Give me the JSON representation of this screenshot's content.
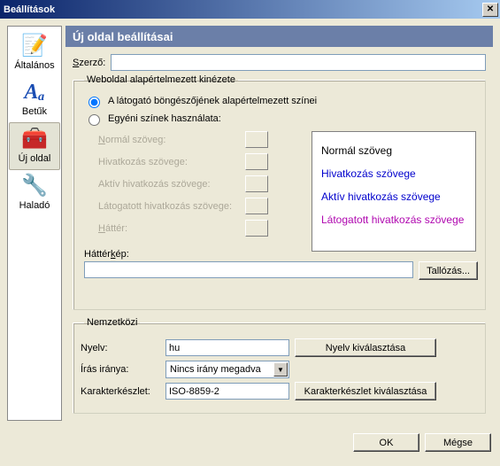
{
  "window": {
    "title": "Beállítások"
  },
  "sidebar": {
    "items": [
      {
        "label": "Általános",
        "glyph": "📝"
      },
      {
        "label": "Betűk",
        "glyph": "Aₐ"
      },
      {
        "label": "Új oldal",
        "glyph": "🧰"
      },
      {
        "label": "Haladó",
        "glyph": "🔧"
      }
    ]
  },
  "section": {
    "title": "Új oldal beállításai"
  },
  "author": {
    "label": "Szerző:",
    "value": ""
  },
  "appearance": {
    "legend": "Weboldal alapértelmezett kinézete",
    "radio_default": "A látogató böngészőjének alapértelmezett színei",
    "radio_custom": "Egyéni színek használata:",
    "labels": {
      "normal": "Normál szöveg:",
      "link": "Hivatkozás szövege:",
      "alink": "Aktív hivatkozás szövege:",
      "vlink": "Látogatott hivatkozás szövege:",
      "bg": "Háttér:"
    },
    "preview": {
      "normal": "Normál szöveg",
      "link": "Hivatkozás szövege",
      "alink": "Aktív hivatkozás szövege",
      "vlink": "Látogatott hivatkozás szövege"
    },
    "bgimage_label": "Háttérkép:",
    "bgimage_value": "",
    "browse": "Tallózás..."
  },
  "intl": {
    "legend": "Nemzetközi",
    "lang_label": "Nyelv:",
    "lang_value": "hu",
    "lang_btn": "Nyelv kiválasztása",
    "dir_label": "Írás iránya:",
    "dir_value": "Nincs irány megadva",
    "charset_label": "Karakterkészlet:",
    "charset_value": "ISO-8859-2",
    "charset_btn": "Karakterkészlet kiválasztása"
  },
  "footer": {
    "ok": "OK",
    "cancel": "Mégse"
  }
}
